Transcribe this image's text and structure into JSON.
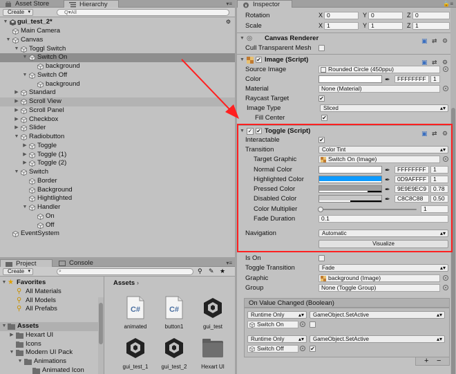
{
  "hierarchy": {
    "tabs": {
      "asset_store": "Asset Store",
      "hierarchy": "Hierarchy"
    },
    "create_label": "Create",
    "search_placeholder": "Q▾All",
    "scene_name": "gui_test_2*",
    "items": [
      {
        "label": "Main Camera"
      },
      {
        "label": "Canvas"
      },
      {
        "label": "Toggl Switch"
      },
      {
        "label": "Switch On"
      },
      {
        "label": "background"
      },
      {
        "label": "Switch Off"
      },
      {
        "label": "background"
      },
      {
        "label": "Standard"
      },
      {
        "label": "Scroll View"
      },
      {
        "label": "Scroll Panel"
      },
      {
        "label": "Checkbox"
      },
      {
        "label": "Slider"
      },
      {
        "label": "Radiobutton"
      },
      {
        "label": "Toggle"
      },
      {
        "label": "Toggle (1)"
      },
      {
        "label": "Toggle (2)"
      },
      {
        "label": "Switch"
      },
      {
        "label": "Border"
      },
      {
        "label": "Background"
      },
      {
        "label": "Hightlighted"
      },
      {
        "label": "Handler"
      },
      {
        "label": "On"
      },
      {
        "label": "Off"
      },
      {
        "label": "EventSystem"
      }
    ]
  },
  "project": {
    "tabs": {
      "project": "Project",
      "console": "Console"
    },
    "create_label": "Create",
    "breadcrumb": "Assets",
    "favorites": {
      "title": "Favorites",
      "items": [
        "All Materials",
        "All Models",
        "All Prefabs"
      ]
    },
    "tree": {
      "root": "Assets",
      "items": [
        "Hexart UI",
        "Icons",
        "Modern UI Pack",
        "Animations",
        "Animated Icon"
      ]
    },
    "assets": [
      {
        "label": "animated",
        "icon": "csharp-script-icon",
        "icon_text": "C#"
      },
      {
        "label": "button1",
        "icon": "csharp-script-icon",
        "icon_text": "C#"
      },
      {
        "label": "gui_test",
        "icon": "unity-scene-icon"
      },
      {
        "label": "gui_test_1",
        "icon": "unity-scene-icon"
      },
      {
        "label": "gui_test_2",
        "icon": "unity-scene-icon"
      },
      {
        "label": "Hexart UI",
        "icon": "folder-icon"
      }
    ]
  },
  "inspector": {
    "tab": "Inspector",
    "rotation": {
      "label": "Rotation",
      "x": "0",
      "y": "0",
      "z": "0"
    },
    "scale": {
      "label": "Scale",
      "x": "1",
      "y": "1",
      "z": "1"
    },
    "canvas_renderer": {
      "title": "Canvas Renderer",
      "cull_label": "Cull Transparent Mesh"
    },
    "image": {
      "title": "Image (Script)",
      "source_image_label": "Source Image",
      "source_image": "Rounded Circle (450ppu)",
      "color_label": "Color",
      "color_hex": "FFFFFFFF",
      "color_alpha": "1",
      "material_label": "Material",
      "material": "None (Material)",
      "raycast_label": "Raycast Target",
      "image_type_label": "Image Type",
      "image_type": "Sliced",
      "fill_center_label": "Fill Center"
    },
    "toggle": {
      "title": "Toggle (Script)",
      "interactable_label": "Interactable",
      "transition_label": "Transition",
      "transition": "Color Tint",
      "target_graphic_label": "Target Graphic",
      "target_graphic": "Switch On (Image)",
      "normal_color_label": "Normal Color",
      "normal_color_hex": "FFFFFFFF",
      "normal_color_alpha": "1",
      "highlighted_color_label": "Highlighted Color",
      "highlighted_color_hex": "0D9AFFFF",
      "highlighted_color_alpha": "1",
      "pressed_color_label": "Pressed Color",
      "pressed_color_hex": "9E9E9EC9",
      "pressed_color_alpha": "0.78",
      "disabled_color_label": "Disabled Color",
      "disabled_color_hex": "C8C8C88",
      "disabled_color_alpha": "0.50",
      "color_multiplier_label": "Color Multiplier",
      "color_multiplier": "1",
      "color_multiplier_fraction": 0.0,
      "fade_duration_label": "Fade Duration",
      "fade_duration": "0.1",
      "navigation_label": "Navigation",
      "navigation": "Automatic",
      "visualize_label": "Visualize",
      "is_on_label": "Is On",
      "toggle_transition_label": "Toggle Transition",
      "toggle_transition": "Fade",
      "graphic_label": "Graphic",
      "graphic": "background (Image)",
      "group_label": "Group",
      "group": "None (Toggle Group)"
    },
    "on_value_changed": {
      "title": "On Value Changed (Boolean)",
      "entries": [
        {
          "runtime": "Runtime Only",
          "function": "GameObject.SetActive",
          "object": "Switch On"
        },
        {
          "runtime": "Runtime Only",
          "function": "GameObject.SetActive",
          "object": "Switch Off"
        }
      ],
      "add": "+",
      "remove": "−"
    }
  },
  "colors": {
    "highlighted": "#0d9aff",
    "pressed": "#9e9e9e",
    "disabled": "#c8c8c8",
    "annotation": "#ff2020",
    "selection": "#8e8e8e"
  }
}
